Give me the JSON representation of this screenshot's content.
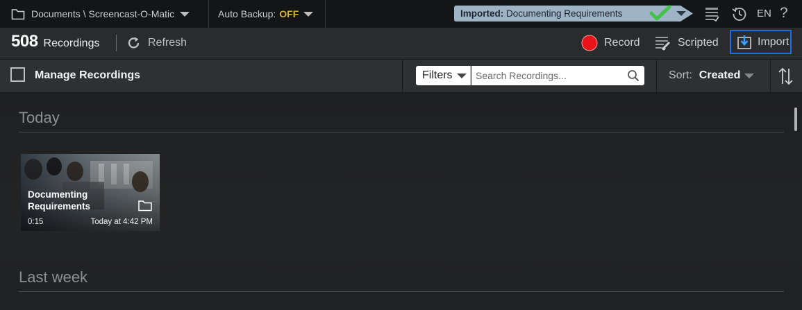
{
  "topbar": {
    "folder_path": "Documents \\ Screencast-O-Matic",
    "backup_label": "Auto Backup:",
    "backup_state": "OFF",
    "import_status_label": "Imported:",
    "import_status_name": "Documenting Requirements",
    "language": "EN"
  },
  "toolbar": {
    "count": "508",
    "count_label": "Recordings",
    "refresh_label": "Refresh",
    "record_label": "Record",
    "scripted_label": "Scripted",
    "import_label": "Import"
  },
  "filterbar": {
    "manage_label": "Manage Recordings",
    "filters_label": "Filters",
    "search_placeholder": "Search Recordings...",
    "sort_label": "Sort:",
    "sort_value": "Created"
  },
  "sections": [
    {
      "title": "Today"
    },
    {
      "title": "Last week"
    }
  ],
  "recordings": [
    {
      "title_line1": "Documenting",
      "title_line2": "Requirements",
      "duration": "0:15",
      "date": "Today at 4:42 PM"
    }
  ],
  "colors": {
    "accent_blue": "#1e6ee8",
    "record_red": "#e8141a",
    "backup_off": "#d6b43a",
    "check_green": "#43c14a"
  }
}
